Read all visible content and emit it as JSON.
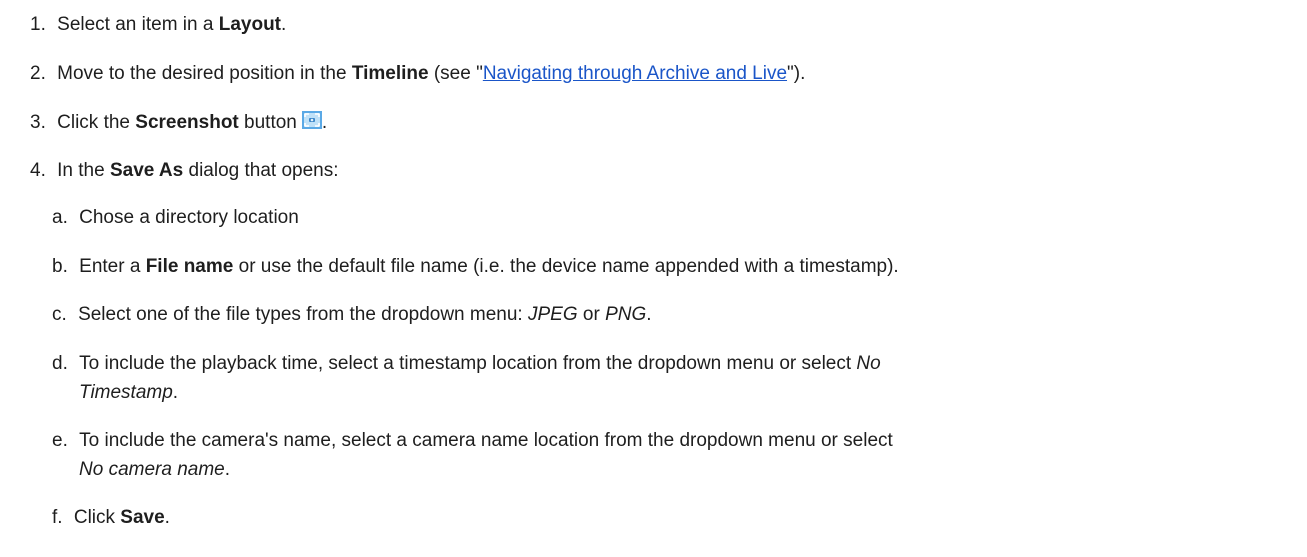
{
  "steps": {
    "s1": {
      "num": "1.",
      "pre": "Select an item in a ",
      "bold": "Layout",
      "post": "."
    },
    "s2": {
      "num": "2.",
      "pre": "Move to the desired position in the ",
      "bold": "Timeline",
      "mid": " (see \"",
      "link": "Navigating through Archive and Live",
      "post": "\")."
    },
    "s3": {
      "num": "3.",
      "pre": "Click the ",
      "bold": "Screenshot",
      "mid": " button",
      "post": ".",
      "icon": "screenshot-icon"
    },
    "s4": {
      "num": "4.",
      "pre": "In the ",
      "bold": "Save As",
      "post": " dialog that opens:"
    }
  },
  "substeps": {
    "a": {
      "letter": "a.",
      "text": "Chose a directory location"
    },
    "b": {
      "letter": "b.",
      "pre": "Enter a ",
      "bold": "File name",
      "post": " or use the default file name (i.e. the device name appended with a timestamp)."
    },
    "c": {
      "letter": "c.",
      "pre": "Select one of the file types from the dropdown menu: ",
      "it1": "JPEG",
      "mid": " or ",
      "it2": "PNG",
      "post": "."
    },
    "d": {
      "letter": "d.",
      "pre": "To include the playback time, select a timestamp location from the dropdown menu or select ",
      "it1": "No",
      "it2": "Timestamp",
      "post": "."
    },
    "e": {
      "letter": "e.",
      "pre": "To include the camera's name, select a camera name location from the dropdown menu or select",
      "it": "No camera name",
      "post": "."
    },
    "f": {
      "letter": "f.",
      "pre": "Click ",
      "bold": "Save",
      "post": "."
    }
  }
}
